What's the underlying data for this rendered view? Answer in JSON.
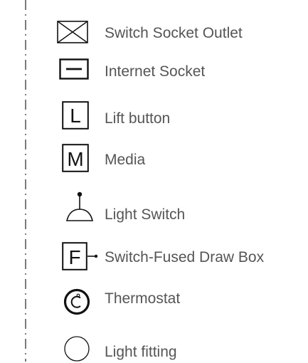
{
  "colors": {
    "symbol": "#111111",
    "label": "#555555",
    "border": "#222222"
  },
  "legend": {
    "items": [
      {
        "symbol": "crossed-box",
        "label": "Switch Socket Outlet"
      },
      {
        "symbol": "dash-box",
        "label": "Internet Socket"
      },
      {
        "symbol": "letter-box",
        "letter": "L",
        "label": "Lift button"
      },
      {
        "symbol": "letter-box",
        "letter": "M",
        "label": "Media"
      },
      {
        "symbol": "bell-switch",
        "label": "Light Switch"
      },
      {
        "symbol": "letter-box-stub",
        "letter": "F",
        "label": "Switch-Fused Draw Box"
      },
      {
        "symbol": "c-circle",
        "label": "Thermostat"
      },
      {
        "symbol": "open-circle",
        "label": "Light fitting"
      }
    ]
  }
}
